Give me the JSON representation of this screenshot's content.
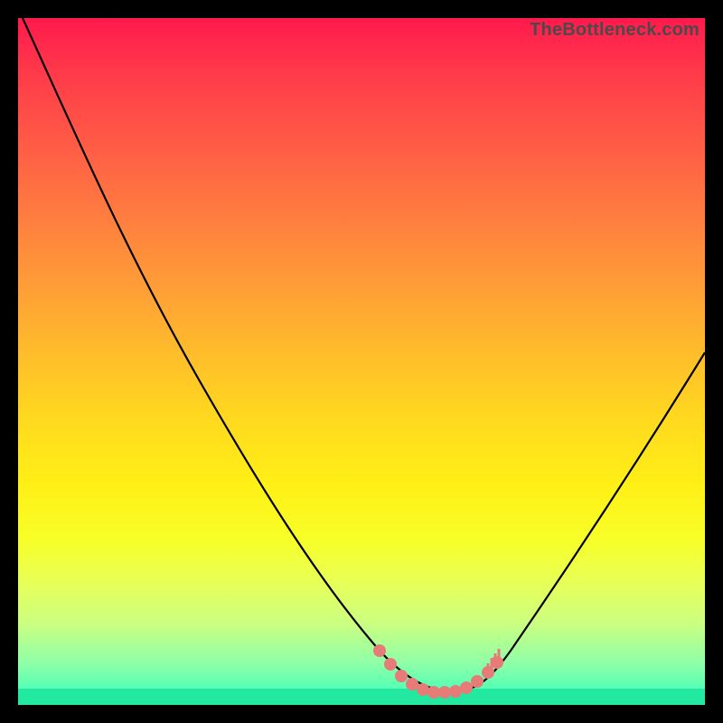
{
  "watermark": "TheBottleneck.com",
  "colors": {
    "frame": "#000000",
    "curve": "#000000",
    "marker_fill": "#e77b78",
    "marker_stroke": "#e77b78"
  },
  "chart_data": {
    "type": "line",
    "title": "",
    "xlabel": "",
    "ylabel": "",
    "xlim": [
      0,
      100
    ],
    "ylim": [
      0,
      100
    ],
    "grid": false,
    "legend": false,
    "series": [
      {
        "name": "bottleneck-curve",
        "x": [
          0,
          5,
          10,
          15,
          20,
          25,
          30,
          35,
          40,
          45,
          50,
          52,
          55,
          58,
          62,
          66,
          70,
          75,
          80,
          85,
          90,
          95,
          100
        ],
        "y": [
          100,
          94,
          87,
          80,
          72,
          64,
          55,
          46,
          37,
          27,
          17,
          11,
          6,
          3,
          2,
          2,
          4,
          10,
          20,
          30,
          40,
          49,
          57
        ]
      }
    ],
    "markers": {
      "name": "highlight-segment",
      "x_range": [
        52,
        70
      ],
      "y_approx": 2,
      "points": [
        {
          "x": 52.5,
          "y": 9.5
        },
        {
          "x": 54.0,
          "y": 6.0
        },
        {
          "x": 56.0,
          "y": 3.8
        },
        {
          "x": 58.0,
          "y": 2.6
        },
        {
          "x": 60.0,
          "y": 2.1
        },
        {
          "x": 62.0,
          "y": 1.9
        },
        {
          "x": 64.0,
          "y": 2.1
        },
        {
          "x": 66.0,
          "y": 2.8
        },
        {
          "x": 67.5,
          "y": 3.8
        },
        {
          "x": 69.0,
          "y": 5.4
        }
      ]
    }
  }
}
